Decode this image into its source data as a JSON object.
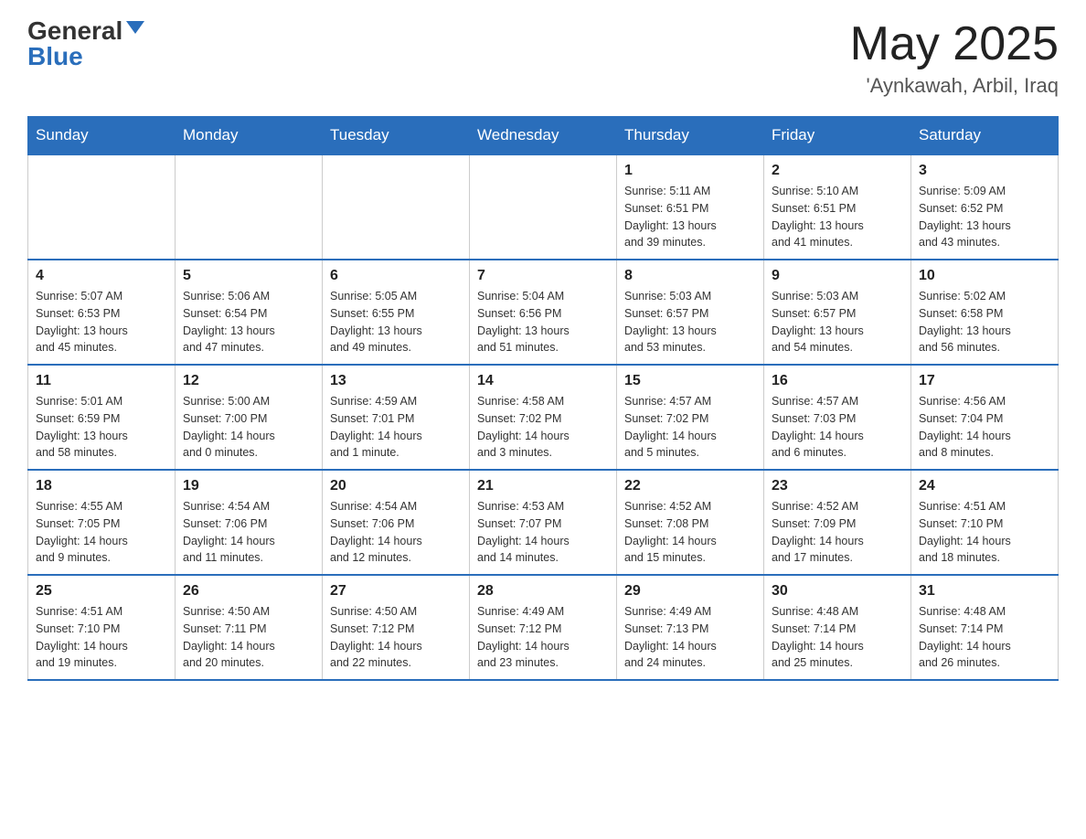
{
  "header": {
    "logo_general": "General",
    "logo_blue": "Blue",
    "month_year": "May 2025",
    "location": "'Aynkawah, Arbil, Iraq"
  },
  "days_of_week": [
    "Sunday",
    "Monday",
    "Tuesday",
    "Wednesday",
    "Thursday",
    "Friday",
    "Saturday"
  ],
  "weeks": [
    [
      {
        "day": "",
        "info": ""
      },
      {
        "day": "",
        "info": ""
      },
      {
        "day": "",
        "info": ""
      },
      {
        "day": "",
        "info": ""
      },
      {
        "day": "1",
        "info": "Sunrise: 5:11 AM\nSunset: 6:51 PM\nDaylight: 13 hours\nand 39 minutes."
      },
      {
        "day": "2",
        "info": "Sunrise: 5:10 AM\nSunset: 6:51 PM\nDaylight: 13 hours\nand 41 minutes."
      },
      {
        "day": "3",
        "info": "Sunrise: 5:09 AM\nSunset: 6:52 PM\nDaylight: 13 hours\nand 43 minutes."
      }
    ],
    [
      {
        "day": "4",
        "info": "Sunrise: 5:07 AM\nSunset: 6:53 PM\nDaylight: 13 hours\nand 45 minutes."
      },
      {
        "day": "5",
        "info": "Sunrise: 5:06 AM\nSunset: 6:54 PM\nDaylight: 13 hours\nand 47 minutes."
      },
      {
        "day": "6",
        "info": "Sunrise: 5:05 AM\nSunset: 6:55 PM\nDaylight: 13 hours\nand 49 minutes."
      },
      {
        "day": "7",
        "info": "Sunrise: 5:04 AM\nSunset: 6:56 PM\nDaylight: 13 hours\nand 51 minutes."
      },
      {
        "day": "8",
        "info": "Sunrise: 5:03 AM\nSunset: 6:57 PM\nDaylight: 13 hours\nand 53 minutes."
      },
      {
        "day": "9",
        "info": "Sunrise: 5:03 AM\nSunset: 6:57 PM\nDaylight: 13 hours\nand 54 minutes."
      },
      {
        "day": "10",
        "info": "Sunrise: 5:02 AM\nSunset: 6:58 PM\nDaylight: 13 hours\nand 56 minutes."
      }
    ],
    [
      {
        "day": "11",
        "info": "Sunrise: 5:01 AM\nSunset: 6:59 PM\nDaylight: 13 hours\nand 58 minutes."
      },
      {
        "day": "12",
        "info": "Sunrise: 5:00 AM\nSunset: 7:00 PM\nDaylight: 14 hours\nand 0 minutes."
      },
      {
        "day": "13",
        "info": "Sunrise: 4:59 AM\nSunset: 7:01 PM\nDaylight: 14 hours\nand 1 minute."
      },
      {
        "day": "14",
        "info": "Sunrise: 4:58 AM\nSunset: 7:02 PM\nDaylight: 14 hours\nand 3 minutes."
      },
      {
        "day": "15",
        "info": "Sunrise: 4:57 AM\nSunset: 7:02 PM\nDaylight: 14 hours\nand 5 minutes."
      },
      {
        "day": "16",
        "info": "Sunrise: 4:57 AM\nSunset: 7:03 PM\nDaylight: 14 hours\nand 6 minutes."
      },
      {
        "day": "17",
        "info": "Sunrise: 4:56 AM\nSunset: 7:04 PM\nDaylight: 14 hours\nand 8 minutes."
      }
    ],
    [
      {
        "day": "18",
        "info": "Sunrise: 4:55 AM\nSunset: 7:05 PM\nDaylight: 14 hours\nand 9 minutes."
      },
      {
        "day": "19",
        "info": "Sunrise: 4:54 AM\nSunset: 7:06 PM\nDaylight: 14 hours\nand 11 minutes."
      },
      {
        "day": "20",
        "info": "Sunrise: 4:54 AM\nSunset: 7:06 PM\nDaylight: 14 hours\nand 12 minutes."
      },
      {
        "day": "21",
        "info": "Sunrise: 4:53 AM\nSunset: 7:07 PM\nDaylight: 14 hours\nand 14 minutes."
      },
      {
        "day": "22",
        "info": "Sunrise: 4:52 AM\nSunset: 7:08 PM\nDaylight: 14 hours\nand 15 minutes."
      },
      {
        "day": "23",
        "info": "Sunrise: 4:52 AM\nSunset: 7:09 PM\nDaylight: 14 hours\nand 17 minutes."
      },
      {
        "day": "24",
        "info": "Sunrise: 4:51 AM\nSunset: 7:10 PM\nDaylight: 14 hours\nand 18 minutes."
      }
    ],
    [
      {
        "day": "25",
        "info": "Sunrise: 4:51 AM\nSunset: 7:10 PM\nDaylight: 14 hours\nand 19 minutes."
      },
      {
        "day": "26",
        "info": "Sunrise: 4:50 AM\nSunset: 7:11 PM\nDaylight: 14 hours\nand 20 minutes."
      },
      {
        "day": "27",
        "info": "Sunrise: 4:50 AM\nSunset: 7:12 PM\nDaylight: 14 hours\nand 22 minutes."
      },
      {
        "day": "28",
        "info": "Sunrise: 4:49 AM\nSunset: 7:12 PM\nDaylight: 14 hours\nand 23 minutes."
      },
      {
        "day": "29",
        "info": "Sunrise: 4:49 AM\nSunset: 7:13 PM\nDaylight: 14 hours\nand 24 minutes."
      },
      {
        "day": "30",
        "info": "Sunrise: 4:48 AM\nSunset: 7:14 PM\nDaylight: 14 hours\nand 25 minutes."
      },
      {
        "day": "31",
        "info": "Sunrise: 4:48 AM\nSunset: 7:14 PM\nDaylight: 14 hours\nand 26 minutes."
      }
    ]
  ]
}
